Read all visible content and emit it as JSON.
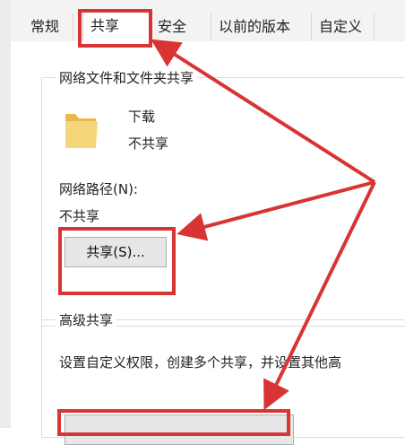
{
  "tabs": [
    {
      "label": "常规"
    },
    {
      "label": "共享"
    },
    {
      "label": "安全"
    },
    {
      "label": "以前的版本"
    },
    {
      "label": "自定义"
    }
  ],
  "network_share": {
    "group_title": "网络文件和文件夹共享",
    "folder_name": "下载",
    "folder_status": "不共享",
    "path_label": "网络路径(N):",
    "path_value": "不共享",
    "share_button": "共享(S)..."
  },
  "advanced_share": {
    "group_title": "高级共享",
    "description": "设置自定义权限，创建多个共享，并设置其他高"
  },
  "annotation": {
    "color": "#d83434"
  }
}
